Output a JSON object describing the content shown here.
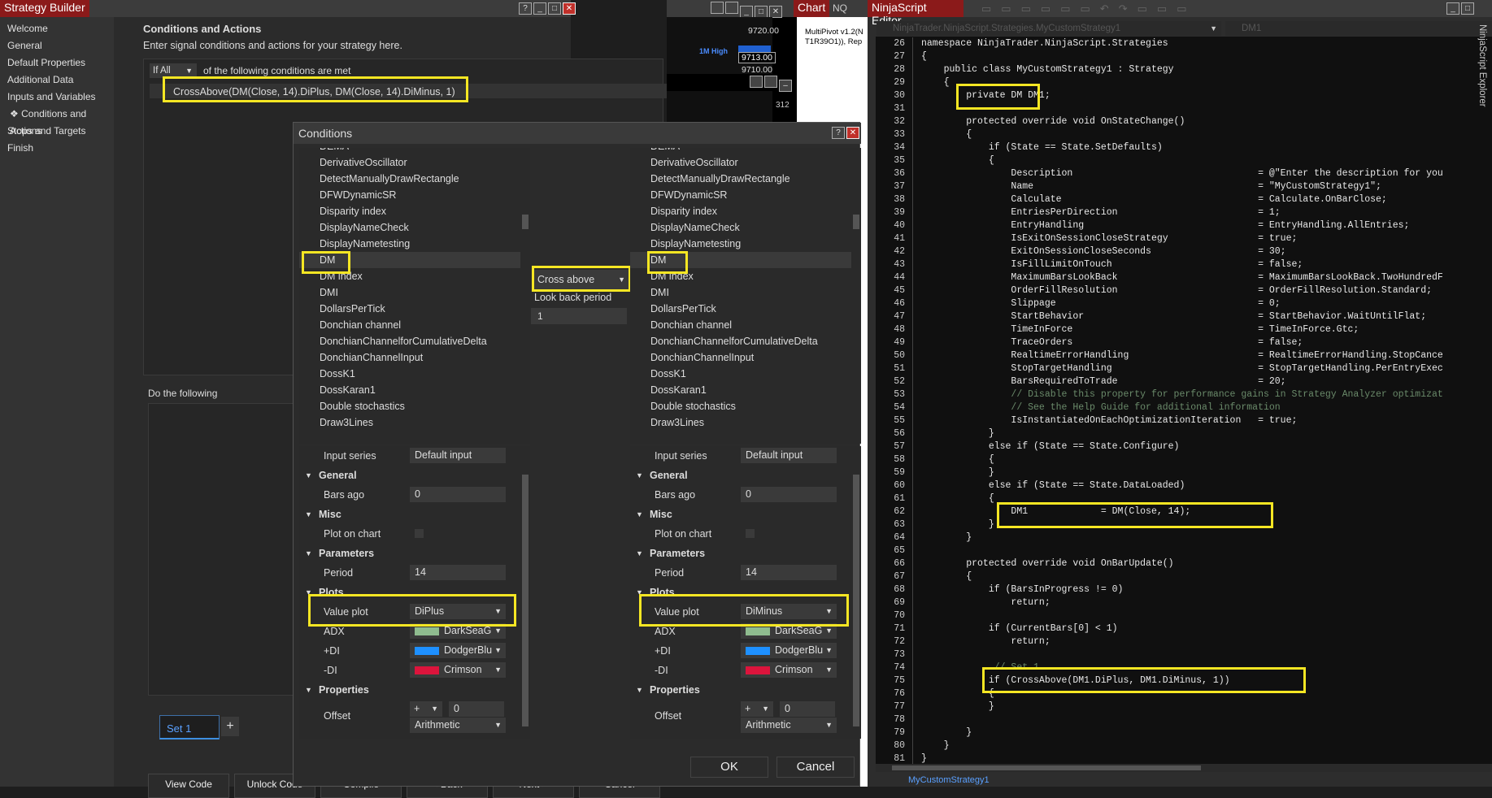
{
  "strategy_builder": {
    "title": "Strategy Builder",
    "sidebar": [
      "Welcome",
      "General",
      "Default Properties",
      "Additional Data",
      "Inputs and Variables",
      "Conditions and Actions",
      "Stops and Targets",
      "Finish"
    ],
    "section_title": "Conditions and Actions",
    "section_desc": "Enter signal conditions and actions for your strategy here.",
    "if_all": "If All",
    "cond_suffix": "of the following conditions are met",
    "condition_expr": "CrossAbove(DM(Close, 14).DiPlus, DM(Close, 14).DiMinus, 1)",
    "do_following": "Do the following",
    "set_tab": "Set 1",
    "add_tab": "+",
    "bottom_buttons": [
      "View Code",
      "Unlock Code",
      "Compile",
      "< Back",
      "Next >",
      "Cancel"
    ]
  },
  "conditions_dialog": {
    "title": "Conditions",
    "help": "?",
    "close": "✕",
    "operator": "Cross above",
    "lookback_label": "Look back period",
    "lookback_value": "1",
    "ok": "OK",
    "cancel": "Cancel",
    "list_items": [
      "DEMA",
      "DerivativeOscillator",
      "DetectManuallyDrawRectangle",
      "DFWDynamicSR",
      "Disparity index",
      "DisplayNameCheck",
      "DisplayNametesting",
      "DM",
      "DM index",
      "DMI",
      "DollarsPerTick",
      "Donchian channel",
      "DonchianChannelforCumulativeDelta",
      "DonchianChannelInput",
      "DossK1",
      "DossKaran1",
      "Double stochastics",
      "Draw3Lines"
    ],
    "left": {
      "input_series": "Input series",
      "input_value": "Default input",
      "general": "General",
      "bars_ago": "Bars ago",
      "bars_ago_val": "0",
      "misc": "Misc",
      "plot_on_chart": "Plot on chart",
      "parameters": "Parameters",
      "period": "Period",
      "period_val": "14",
      "plots": "Plots",
      "value_plot": "Value plot",
      "value_plot_val": "DiPlus",
      "adx": "ADX",
      "adx_color": "DarkSeaG",
      "pdi": "+DI",
      "pdi_color": "DodgerBlu",
      "mdi": "-DI",
      "mdi_color": "Crimson",
      "properties": "Properties",
      "offset": "Offset",
      "offset_op": "+",
      "offset_val": "0",
      "offset_type": "Arithmetic"
    },
    "right": {
      "input_series": "Input series",
      "input_value": "Default input",
      "general": "General",
      "bars_ago": "Bars ago",
      "bars_ago_val": "0",
      "misc": "Misc",
      "plot_on_chart": "Plot on chart",
      "parameters": "Parameters",
      "period": "Period",
      "period_val": "14",
      "plots": "Plots",
      "value_plot": "Value plot",
      "value_plot_val": "DiMinus",
      "adx": "ADX",
      "adx_color": "DarkSeaG",
      "pdi": "+DI",
      "pdi_color": "DodgerBlu",
      "mdi": "-DI",
      "mdi_color": "Crimson",
      "properties": "Properties",
      "offset": "Offset",
      "offset_op": "+",
      "offset_val": "0",
      "offset_type": "Arithmetic"
    }
  },
  "chart": {
    "title": "Chart",
    "tab": "NQ",
    "prices": [
      "9720.00",
      "9713.00",
      "9710.00"
    ],
    "label_high": "1M High",
    "indicator_text_1": "MultiPivot v1.2(N",
    "indicator_text_2": "T1R39O1)), Rep",
    "axis_value": "312"
  },
  "editor": {
    "title": "NinjaScript Editor",
    "namespace_dropdown": "NinjaTrader.NinjaScript.Strategies.MyCustomStrategy1",
    "member_dropdown": "DM1",
    "side_tab": "NinjaScript Explorer",
    "bottom_tab": "MyCustomStrategy1",
    "lines": [
      {
        "n": "26",
        "t": "namespace NinjaTrader.NinjaScript.Strategies"
      },
      {
        "n": "27",
        "t": "{"
      },
      {
        "n": "28",
        "t": "    public class MyCustomStrategy1 : Strategy"
      },
      {
        "n": "29",
        "t": "    {"
      },
      {
        "n": "30",
        "t": "        private DM DM1;"
      },
      {
        "n": "31",
        "t": ""
      },
      {
        "n": "32",
        "t": "        protected override void OnStateChange()"
      },
      {
        "n": "33",
        "t": "        {"
      },
      {
        "n": "34",
        "t": "            if (State == State.SetDefaults)"
      },
      {
        "n": "35",
        "t": "            {"
      },
      {
        "n": "36",
        "t": "                Description                                 = @\"Enter the description for you"
      },
      {
        "n": "37",
        "t": "                Name                                        = \"MyCustomStrategy1\";"
      },
      {
        "n": "38",
        "t": "                Calculate                                   = Calculate.OnBarClose;"
      },
      {
        "n": "39",
        "t": "                EntriesPerDirection                         = 1;"
      },
      {
        "n": "40",
        "t": "                EntryHandling                               = EntryHandling.AllEntries;"
      },
      {
        "n": "41",
        "t": "                IsExitOnSessionCloseStrategy                = true;"
      },
      {
        "n": "42",
        "t": "                ExitOnSessionCloseSeconds                   = 30;"
      },
      {
        "n": "43",
        "t": "                IsFillLimitOnTouch                          = false;"
      },
      {
        "n": "44",
        "t": "                MaximumBarsLookBack                         = MaximumBarsLookBack.TwoHundredF"
      },
      {
        "n": "45",
        "t": "                OrderFillResolution                         = OrderFillResolution.Standard;"
      },
      {
        "n": "46",
        "t": "                Slippage                                    = 0;"
      },
      {
        "n": "47",
        "t": "                StartBehavior                               = StartBehavior.WaitUntilFlat;"
      },
      {
        "n": "48",
        "t": "                TimeInForce                                 = TimeInForce.Gtc;"
      },
      {
        "n": "49",
        "t": "                TraceOrders                                 = false;"
      },
      {
        "n": "50",
        "t": "                RealtimeErrorHandling                       = RealtimeErrorHandling.StopCance"
      },
      {
        "n": "51",
        "t": "                StopTargetHandling                          = StopTargetHandling.PerEntryExec"
      },
      {
        "n": "52",
        "t": "                BarsRequiredToTrade                         = 20;"
      },
      {
        "n": "53",
        "t": "                // Disable this property for performance gains in Strategy Analyzer optimizat"
      },
      {
        "n": "54",
        "t": "                // See the Help Guide for additional information"
      },
      {
        "n": "55",
        "t": "                IsInstantiatedOnEachOptimizationIteration   = true;"
      },
      {
        "n": "56",
        "t": "            }"
      },
      {
        "n": "57",
        "t": "            else if (State == State.Configure)"
      },
      {
        "n": "58",
        "t": "            {"
      },
      {
        "n": "59",
        "t": "            }"
      },
      {
        "n": "60",
        "t": "            else if (State == State.DataLoaded)"
      },
      {
        "n": "61",
        "t": "            {"
      },
      {
        "n": "62",
        "t": "                DM1             = DM(Close, 14);"
      },
      {
        "n": "63",
        "t": "            }"
      },
      {
        "n": "64",
        "t": "        }"
      },
      {
        "n": "65",
        "t": ""
      },
      {
        "n": "66",
        "t": "        protected override void OnBarUpdate()"
      },
      {
        "n": "67",
        "t": "        {"
      },
      {
        "n": "68",
        "t": "            if (BarsInProgress != 0)"
      },
      {
        "n": "69",
        "t": "                return;"
      },
      {
        "n": "70",
        "t": ""
      },
      {
        "n": "71",
        "t": "            if (CurrentBars[0] < 1)"
      },
      {
        "n": "72",
        "t": "                return;"
      },
      {
        "n": "73",
        "t": ""
      },
      {
        "n": "74",
        "t": "             // Set 1"
      },
      {
        "n": "75",
        "t": "            if (CrossAbove(DM1.DiPlus, DM1.DiMinus, 1))"
      },
      {
        "n": "76",
        "t": "            {"
      },
      {
        "n": "77",
        "t": "            }"
      },
      {
        "n": "78",
        "t": ""
      },
      {
        "n": "79",
        "t": "        }"
      },
      {
        "n": "80",
        "t": "    }"
      },
      {
        "n": "81",
        "t": "}"
      }
    ]
  }
}
